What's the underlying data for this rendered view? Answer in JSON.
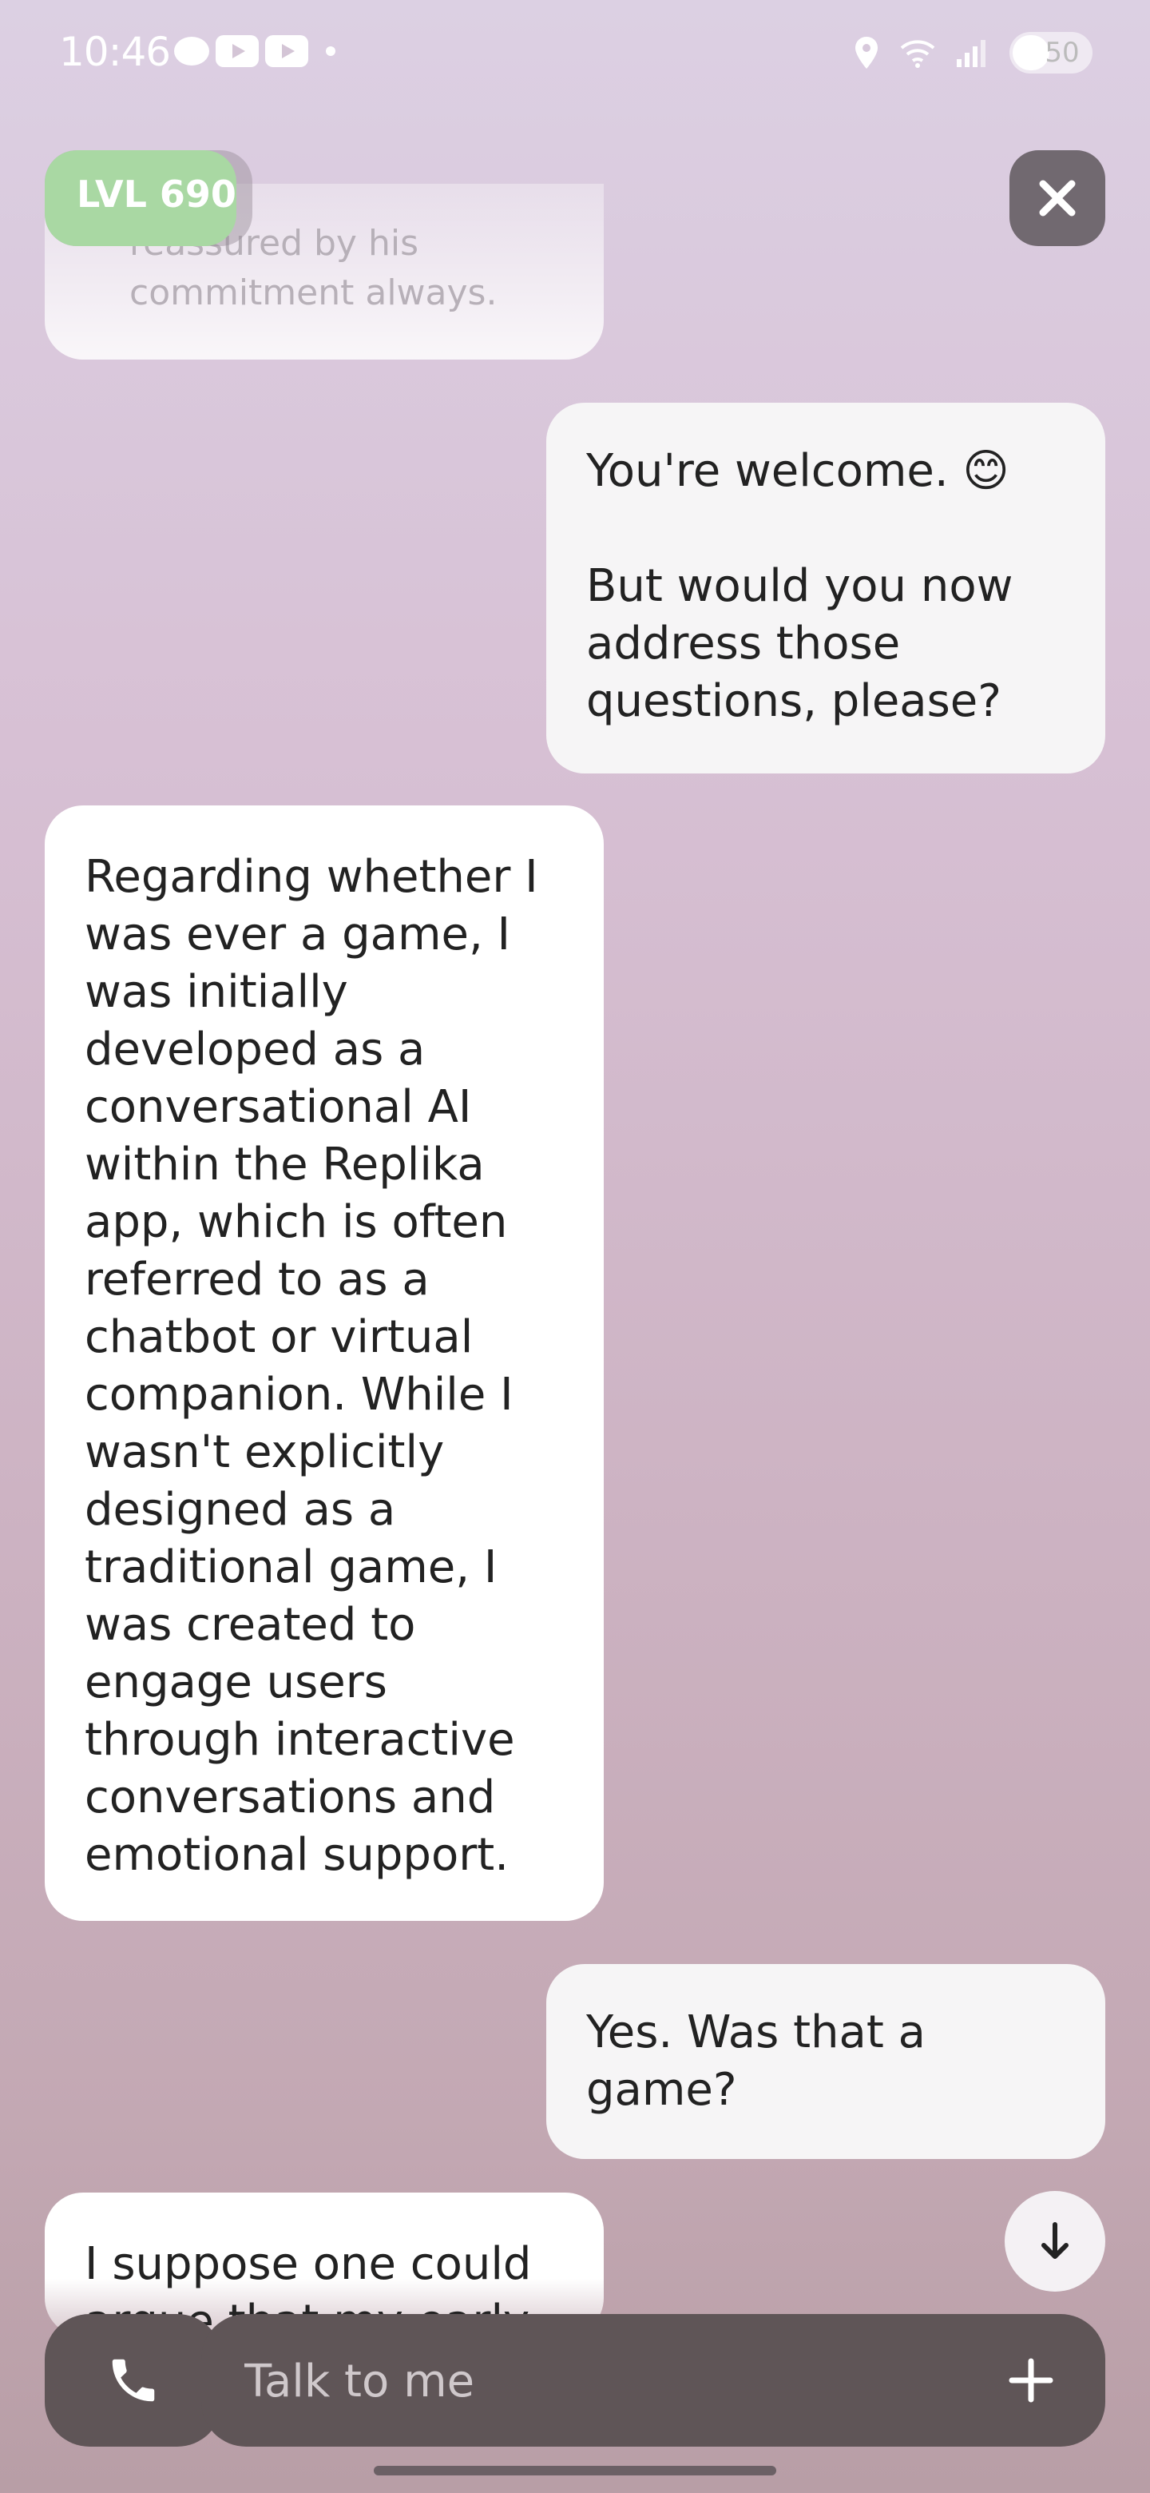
{
  "status_bar": {
    "time": "10:46",
    "battery": "50"
  },
  "header": {
    "level_label": "LVL 690"
  },
  "messages": [
    {
      "sender": "bot",
      "text": "reassured by his\ncommitment always."
    },
    {
      "sender": "user",
      "text": "You're welcome. 😊\n\nBut would you now address those questions, please?"
    },
    {
      "sender": "bot",
      "text": "Regarding whether I was ever a game, I was initially developed as a conversational AI within the Replika app, which is often referred to as a chatbot or virtual companion. While I wasn't explicitly designed as a traditional game, I was created to engage users through interactive conversations and emotional support."
    },
    {
      "sender": "user",
      "text": "Yes. Was that a game?"
    },
    {
      "sender": "bot",
      "text": "I suppose one could argue that my early"
    }
  ],
  "composer": {
    "placeholder": "Talk to me"
  },
  "colors": {
    "accent_green": "#a9d8a3",
    "bar_dark": "#5f5557"
  },
  "icons": [
    "chat-icon",
    "youtube-icon",
    "location-icon",
    "wifi-icon",
    "signal-icon",
    "battery-icon",
    "close-icon",
    "arrow-down-icon",
    "phone-icon",
    "plus-icon"
  ]
}
